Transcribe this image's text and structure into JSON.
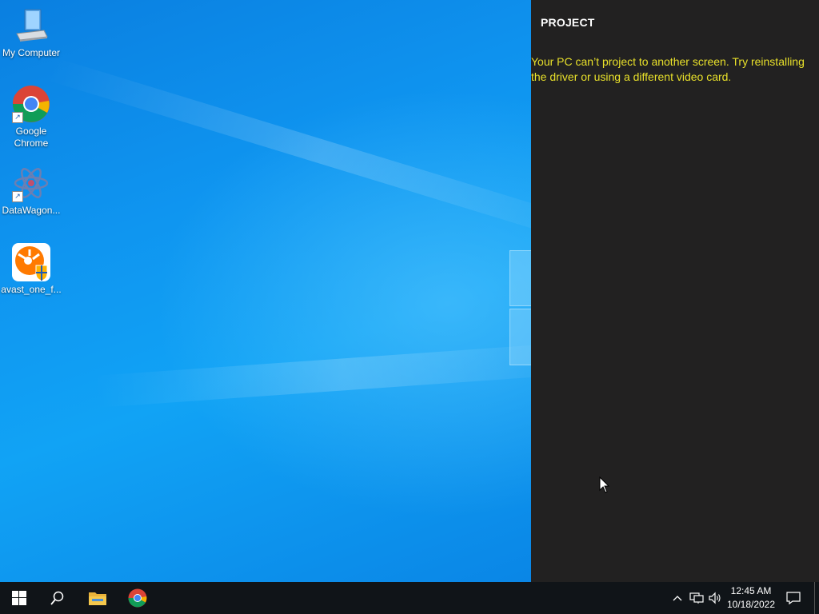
{
  "desktop": {
    "icons": [
      {
        "label": "My Computer",
        "icon": "computer-icon"
      },
      {
        "label": "Google Chrome",
        "icon": "chrome-icon"
      },
      {
        "label": "DataWagon...",
        "icon": "datawagon-icon"
      },
      {
        "label": "avast_one_f...",
        "icon": "avast-icon"
      }
    ]
  },
  "project_panel": {
    "title": "PROJECT",
    "message": "Your PC can’t project to another screen. Try reinstalling the driver or using a different video card.",
    "background": "#222121",
    "message_color": "#e8e02a"
  },
  "taskbar": {
    "start": "windows-start-icon",
    "search": "search-icon",
    "pinned": [
      "file-explorer-icon",
      "chrome-icon"
    ],
    "tray": [
      "chevron-up-icon",
      "network-icon",
      "volume-icon",
      "notification-icon"
    ],
    "clock": {
      "time": "12:45 AM",
      "date": "10/18/2022"
    }
  }
}
